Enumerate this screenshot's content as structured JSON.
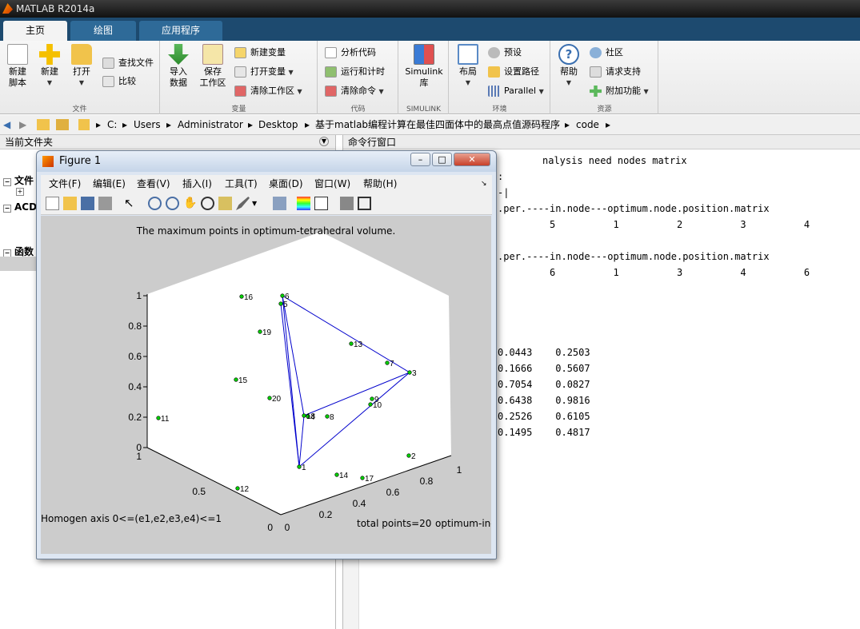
{
  "app": {
    "title": "MATLAB R2014a"
  },
  "tabs": [
    "主页",
    "绘图",
    "应用程序"
  ],
  "ribbon": {
    "file_group": {
      "name": "文件",
      "new_script": "新建\n脚本",
      "new": "新建",
      "open": "打开",
      "find_files": "查找文件",
      "compare": "比较"
    },
    "variable_group": {
      "name": "变量",
      "import": "导入\n数据",
      "save_ws": "保存\n工作区",
      "new_var": "新建变量",
      "open_var": "打开变量",
      "clear_ws": "清除工作区"
    },
    "code_group": {
      "name": "代码",
      "analyze": "分析代码",
      "run_time": "运行和计时",
      "clear_cmd": "清除命令"
    },
    "simulink_group": {
      "name": "SIMULINK",
      "simulink": "Simulink\n库"
    },
    "env_group": {
      "name": "环境",
      "layout": "布局",
      "prefs": "预设",
      "set_path": "设置路径",
      "parallel": "Parallel"
    },
    "resources_group": {
      "name": "资源",
      "help": "帮助",
      "community": "社区",
      "request_support": "请求支持",
      "addons": "附加功能"
    }
  },
  "address": {
    "crumbs": [
      "C:",
      "Users",
      "Administrator",
      "Desktop",
      "基于matlab编程计算在最佳四面体中的最高点值源码程序",
      "code"
    ]
  },
  "left_pane": {
    "title": "当前文件夹",
    "items": [
      "文件",
      "ACD",
      "函数"
    ]
  },
  "command_window": {
    "title": "命令行窗口",
    "lines": [
      "nalysis need nodes matrix",
      ":",
      "-|",
      ".per.----in.node---optimum.node.position.matrix",
      "         5          1          2          3          4",
      ".per.----in.node---optimum.node.position.matrix",
      "         6          1          3          4          6",
      "0.0443    0.2503",
      "0.1666    0.5607",
      "0.7054    0.0827",
      "0.6438    0.9816",
      "0.2526    0.6105",
      "0.1495    0.4817"
    ]
  },
  "figure": {
    "title": "Figure 1",
    "menu": [
      "文件(F)",
      "编辑(E)",
      "查看(V)",
      "插入(I)",
      "工具(T)",
      "桌面(D)",
      "窗口(W)",
      "帮助(H)"
    ],
    "plot_title": "The maximum points in optimum-tetrahedral volume.",
    "footer_left": "Homogen axis 0<=(e1,e2,e3,e4)<=1",
    "footer_mid": "total points=20",
    "footer_right": "optimum-in-p",
    "z_ticks": [
      "0",
      "0.2",
      "0.4",
      "0.6",
      "0.8",
      "1"
    ],
    "y_ticks": [
      "0",
      "0.5",
      "1"
    ],
    "x_ticks": [
      "0",
      "0.2",
      "0.4",
      "0.6",
      "0.8",
      "1"
    ],
    "point_labels": [
      "1",
      "3",
      "4",
      "5",
      "6",
      "7",
      "8",
      "9",
      "10",
      "11",
      "12",
      "13",
      "14",
      "15",
      "16",
      "17",
      "18",
      "19",
      "20",
      "2"
    ],
    "colors": {
      "point": "#00cc00",
      "edge": "#0000cc"
    }
  }
}
